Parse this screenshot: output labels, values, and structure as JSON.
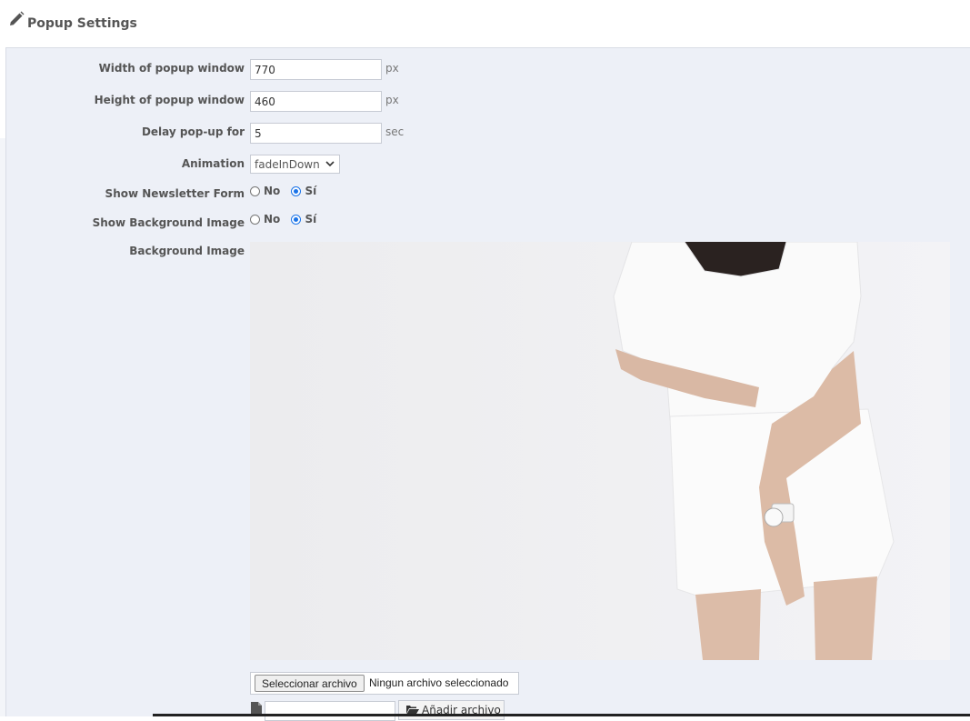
{
  "header": {
    "title": "Popup Settings",
    "icon": "pencil-icon"
  },
  "form": {
    "width": {
      "label": "Width of popup window",
      "value": "770",
      "unit": "px"
    },
    "height": {
      "label": "Height of popup window",
      "value": "460",
      "unit": "px"
    },
    "delay": {
      "label": "Delay pop-up for",
      "value": "5",
      "unit": "sec"
    },
    "animation": {
      "label": "Animation",
      "selected": "fadeInDown"
    },
    "newsletter": {
      "label": "Show Newsletter Form",
      "no": "No",
      "yes": "Sí",
      "selected": "yes"
    },
    "show_bg": {
      "label": "Show Background Image",
      "no": "No",
      "yes": "Sí",
      "selected": "yes"
    },
    "bg_image": {
      "label": "Background Image"
    },
    "file": {
      "button": "Seleccionar archivo",
      "status": "Ningun archivo seleccionado"
    },
    "add_file": {
      "label": "Añadir archivo",
      "icon": "folder-open-icon"
    }
  },
  "colors": {
    "panel_bg": "#edf0f7",
    "radio_accent": "#1a73e8"
  }
}
